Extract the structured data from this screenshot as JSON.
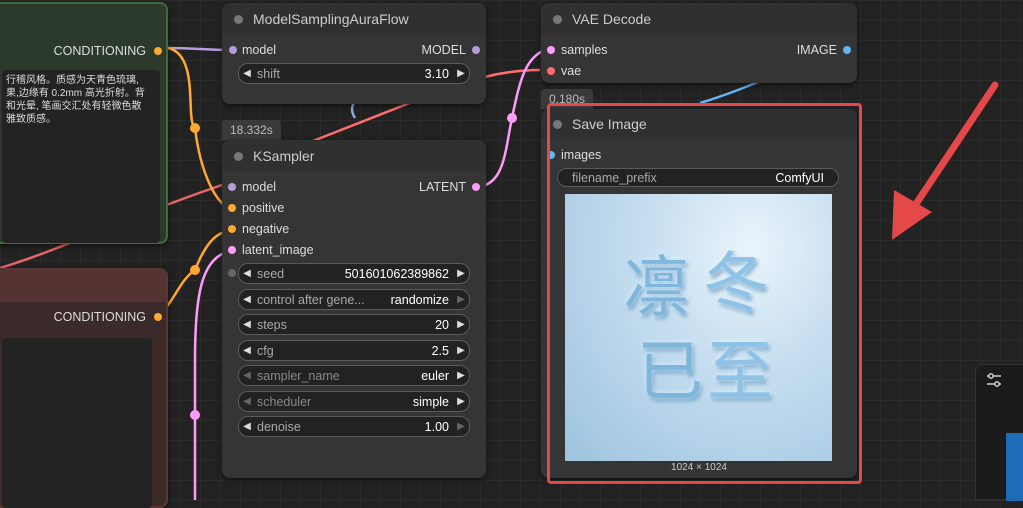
{
  "colors": {
    "clip": "#ffa931",
    "model": "#b39ddb",
    "latent": "#ff9cf9",
    "vae": "#ff6e6e",
    "image": "#64b5f6",
    "highlight": "#e54848"
  },
  "cond_node_top": {
    "output_label": "CONDITIONING",
    "text_lines": [
      "行稽风格。质感为天青色琉璃,",
      "果,边缘有 0.2mm 高光折射。背",
      "和光晕, 笔画交汇处有轻微色散",
      "雅致质感。"
    ]
  },
  "cond_node_bottom": {
    "output_label": "CONDITIONING"
  },
  "model_sampling": {
    "title": "ModelSamplingAuraFlow",
    "input_label": "model",
    "output_label": "MODEL",
    "widgets": [
      {
        "name": "shift",
        "value": "3.10"
      }
    ]
  },
  "vae_decode": {
    "title": "VAE Decode",
    "inputs": [
      "samples",
      "vae"
    ],
    "output_label": "IMAGE",
    "time": "0.180s"
  },
  "ksampler": {
    "title": "KSampler",
    "time": "18.332s",
    "inputs": [
      "model",
      "positive",
      "negative",
      "latent_image"
    ],
    "output_label": "LATENT",
    "widgets": [
      {
        "name": "seed",
        "value": "501601062389862"
      },
      {
        "name": "control after gene...",
        "value": "randomize"
      },
      {
        "name": "steps",
        "value": "20"
      },
      {
        "name": "cfg",
        "value": "2.5"
      },
      {
        "name": "sampler_name",
        "value": "euler"
      },
      {
        "name": "scheduler",
        "value": "simple"
      },
      {
        "name": "denoise",
        "value": "1.00"
      }
    ]
  },
  "save_image": {
    "title": "Save Image",
    "input_label": "images",
    "filename_prefix_label": "filename_prefix",
    "filename_prefix_value": "ComfyUI",
    "image_chars": [
      "凛",
      "冬",
      "已",
      "至"
    ],
    "image_size": "1024 × 1024"
  },
  "side_panel": {
    "icon": "sliders-icon"
  }
}
